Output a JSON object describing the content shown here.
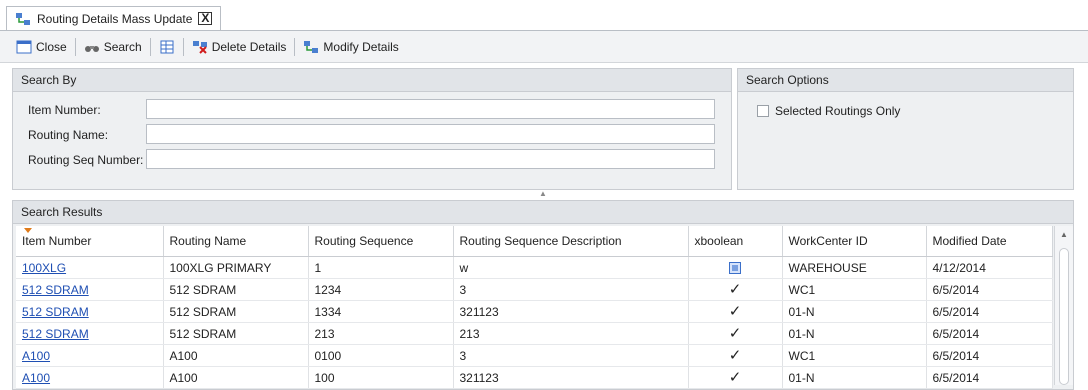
{
  "tab": {
    "title": "Routing Details Mass Update",
    "close": "X"
  },
  "toolbar": {
    "close": "Close",
    "search": "Search",
    "delete": "Delete Details",
    "modify": "Modify Details"
  },
  "search_by": {
    "header": "Search By",
    "item_number_label": "Item Number:",
    "routing_name_label": "Routing Name:",
    "routing_seq_label": "Routing Seq Number:",
    "item_number_value": "",
    "routing_name_value": "",
    "routing_seq_value": ""
  },
  "search_options": {
    "header": "Search Options",
    "selected_only_label": "Selected Routings Only",
    "selected_only_checked": false
  },
  "results": {
    "header": "Search Results",
    "columns": [
      "Item Number",
      "Routing Name",
      "Routing Sequence",
      "Routing Sequence Description",
      "xboolean",
      "WorkCenter ID",
      "Modified Date"
    ],
    "rows": [
      {
        "item": "100XLG",
        "name": "100XLG PRIMARY",
        "seq": "1",
        "desc": "w",
        "bool": "box",
        "wc": "WAREHOUSE",
        "date": "4/12/2014"
      },
      {
        "item": "512 SDRAM",
        "name": "512 SDRAM",
        "seq": "1234",
        "desc": "3",
        "bool": "check",
        "wc": "WC1",
        "date": "6/5/2014"
      },
      {
        "item": "512 SDRAM",
        "name": "512 SDRAM",
        "seq": "1334",
        "desc": "321123",
        "bool": "check",
        "wc": "01-N",
        "date": "6/5/2014"
      },
      {
        "item": "512 SDRAM",
        "name": "512 SDRAM",
        "seq": "213",
        "desc": "213",
        "bool": "check",
        "wc": "01-N",
        "date": "6/5/2014"
      },
      {
        "item": "A100",
        "name": "A100",
        "seq": "0100",
        "desc": "3",
        "bool": "check",
        "wc": "WC1",
        "date": "6/5/2014"
      },
      {
        "item": "A100",
        "name": "A100",
        "seq": "100",
        "desc": "321123",
        "bool": "check",
        "wc": "01-N",
        "date": "6/5/2014"
      }
    ]
  },
  "colors": {
    "link": "#1f4fb3",
    "panel_bg": "#eef0f2",
    "header_bg": "#e1e4e8",
    "sort_indicator": "#e07b1a"
  },
  "icons": [
    "routing-icon",
    "close-window-icon",
    "search-binoculars-icon",
    "grid-icon",
    "delete-details-icon",
    "modify-details-icon"
  ]
}
